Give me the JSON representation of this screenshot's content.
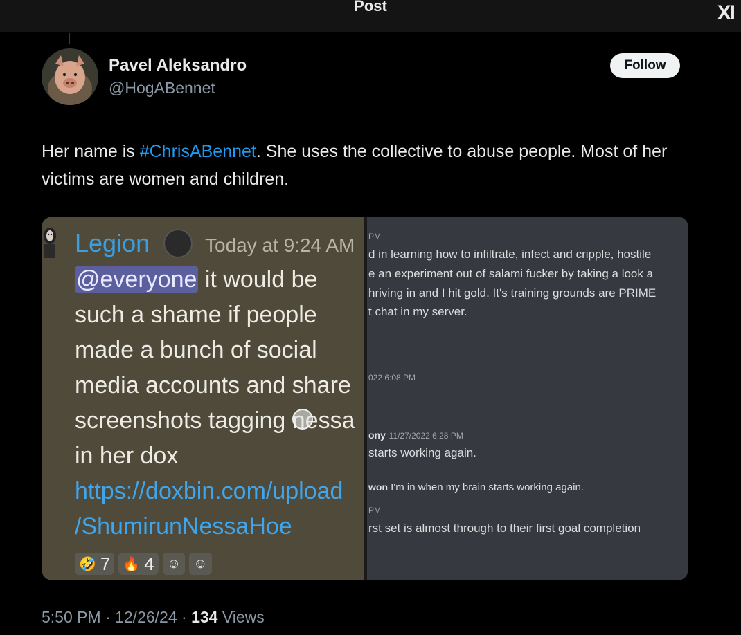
{
  "header": {
    "title": "Post",
    "logo": "XI"
  },
  "author": {
    "name": "Pavel Aleksandro",
    "handle": "@HogABennet",
    "follow_label": "Follow"
  },
  "tweet": {
    "text_before": "Her name is ",
    "hashtag": "#ChrisABennet",
    "text_after": ". She uses the collective to abuse people. Most of her victims are women and children."
  },
  "media": {
    "left": {
      "username": "Legion",
      "timestamp": "Today at 9:24 AM",
      "mention": "@everyone",
      "lines": [
        " it would be",
        "such a shame if people",
        "made a bunch of social",
        "media accounts and share",
        "screenshots tagging nessa",
        "in her dox"
      ],
      "link_lines": [
        "https://doxbin.com/upload",
        "/ShumirunNessaHoe"
      ],
      "reactions": [
        {
          "emoji": "🤣",
          "count": "7"
        },
        {
          "emoji": "🔥",
          "count": "4"
        },
        {
          "emoji": "☺",
          "count": ""
        },
        {
          "emoji": "☺",
          "count": ""
        }
      ]
    },
    "right": {
      "pm1": "PM",
      "lines": [
        "d in learning how to infiltrate, infect and cripple, hostile",
        "e an experiment out of salami fucker by taking a look a",
        "hriving in and I hit gold. It's training grounds are PRIME",
        "t chat in my server."
      ],
      "ts1": "022 6:08 PM",
      "name2": "ony",
      "ts2": "11/27/2022 6:28 PM",
      "line2": "starts working again.",
      "name3": "won",
      "line3": "I'm in when my brain starts working again.",
      "pm2": "PM",
      "line4": "rst set is almost through to their first goal completion"
    }
  },
  "meta": {
    "time": "5:50 PM · 12/26/24 · ",
    "views_count": "134",
    "views_label": " Views"
  }
}
